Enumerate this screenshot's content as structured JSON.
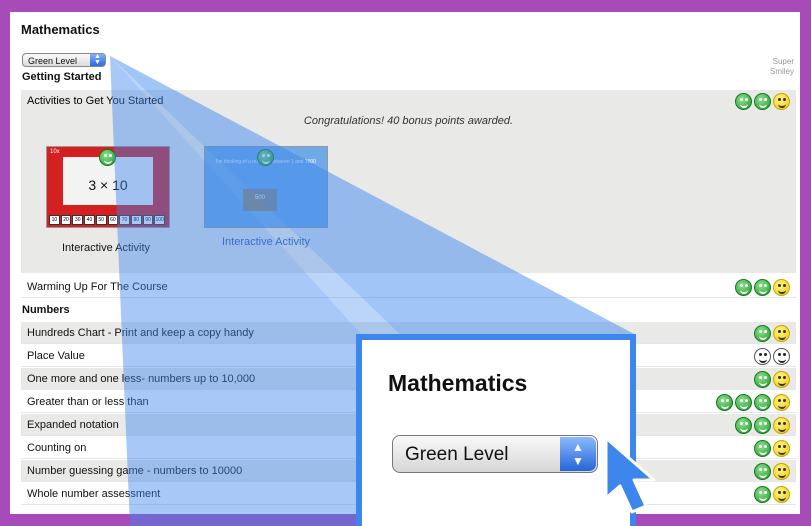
{
  "title": "Mathematics",
  "level_select": {
    "value": "Green Level"
  },
  "super_smiley": [
    "Super",
    "Smiley"
  ],
  "sections": {
    "getting_started": "Getting Started",
    "numbers": "Numbers"
  },
  "activities": {
    "label": "Activities to Get You Started",
    "congrats": "Congratulations! 40 bonus points awarded.",
    "thumb1": {
      "label": "Interactive Activity",
      "expression": "3 × 10",
      "counter": "10x",
      "ruler": [
        "10",
        "20",
        "30",
        "40",
        "50",
        "60",
        "70",
        "80",
        "90",
        "100"
      ]
    },
    "thumb2": {
      "label": "Interactive Activity",
      "banner": "I'm thinking of a number between 1 and 1000",
      "value": "500"
    },
    "smileys": [
      "green",
      "green",
      "yellow"
    ]
  },
  "rows_getting_started": [
    {
      "label": "Warming Up For The Course",
      "smileys": [
        "green",
        "green",
        "yellow"
      ]
    }
  ],
  "rows_numbers": [
    {
      "label": "Hundreds Chart - Print and keep a copy handy",
      "smileys": [
        "green",
        "yellow"
      ]
    },
    {
      "label": "Place Value",
      "smileys": [
        "white",
        "white"
      ]
    },
    {
      "label": "One more and one less- numbers up to 10,000",
      "smileys": [
        "green",
        "yellow"
      ]
    },
    {
      "label": "Greater than or less than",
      "smileys": [
        "green",
        "green",
        "green",
        "yellow"
      ]
    },
    {
      "label": "Expanded notation",
      "smileys": [
        "green",
        "green",
        "yellow"
      ]
    },
    {
      "label": "Counting on",
      "smileys": [
        "green",
        "yellow"
      ]
    },
    {
      "label": "Number guessing game - numbers to 10000",
      "smileys": [
        "green",
        "yellow"
      ]
    },
    {
      "label": "Whole number assessment",
      "smileys": [
        "green",
        "yellow"
      ]
    }
  ],
  "zoom": {
    "title": "Mathematics",
    "select_value": "Green Level"
  },
  "colors": {
    "frame": "#a64bb8",
    "callout": "#3d86ee",
    "row_shade": "#e9e9e7",
    "smiley_green": "#1f9a2a",
    "smiley_yellow": "#f0c800"
  },
  "icons": [
    "smiley-green-icon",
    "smiley-yellow-icon",
    "smiley-empty-icon",
    "cursor-arrow-icon",
    "stepper-arrows-icon"
  ]
}
